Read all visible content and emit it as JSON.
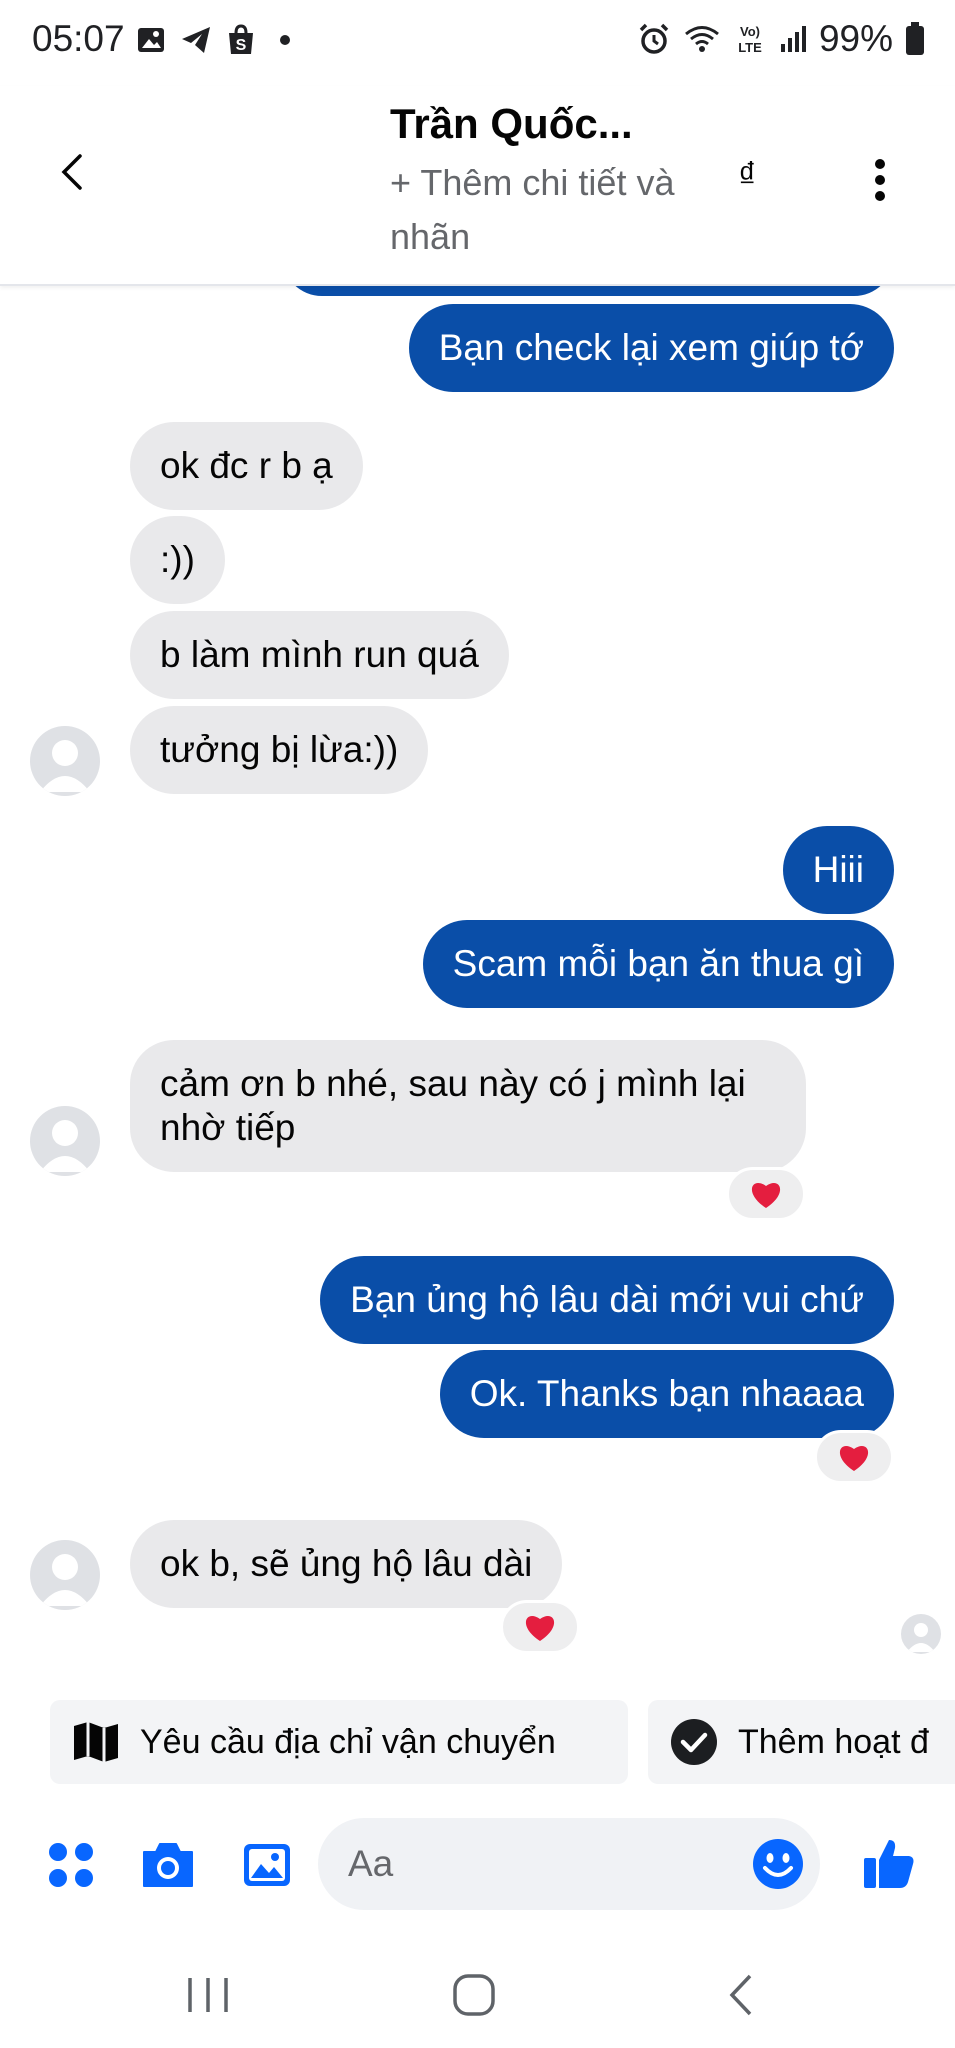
{
  "status_bar": {
    "time": "05:07",
    "battery": "99%",
    "left_icons": [
      "image-icon",
      "telegram-icon",
      "shopee-icon",
      "dot-icon"
    ],
    "right_icons": [
      "alarm-icon",
      "wifi-icon",
      "volte-icon",
      "signal-icon",
      "battery-icon"
    ],
    "volte_label_top": "Vo)",
    "volte_label_bottom": "LTE"
  },
  "header": {
    "contact_name": "Trần Quốc...",
    "add_details": "+ Thêm chi tiết và nhãn",
    "currency_symbol": "₫"
  },
  "messages": [
    {
      "direction": "out",
      "text": "Bạn check lại xem giúp tớ"
    },
    {
      "direction": "in",
      "text": "ok đc r b ạ"
    },
    {
      "direction": "in",
      "text": ":))"
    },
    {
      "direction": "in",
      "text": "b làm mình run quá"
    },
    {
      "direction": "in",
      "text": "tưởng bị lừa:))"
    },
    {
      "direction": "out",
      "text": "Hiii"
    },
    {
      "direction": "out",
      "text": "Scam mỗi bạn ăn thua gì"
    },
    {
      "direction": "in",
      "text": "cảm ơn b nhé, sau này có j mình lại nhờ tiếp",
      "reaction": "heart"
    },
    {
      "direction": "out",
      "text": "Bạn ủng hộ lâu dài mới vui chứ"
    },
    {
      "direction": "out",
      "text": "Ok. Thanks bạn nhaaaa",
      "reaction": "heart"
    },
    {
      "direction": "in",
      "text": "ok b, sẽ ủng hộ lâu dài",
      "reaction": "heart"
    }
  ],
  "quick_actions": [
    {
      "label": "Yêu cầu địa chỉ vận chuyển",
      "icon": "map-icon"
    },
    {
      "label": "Thêm hoạt đ",
      "icon": "check-circle-icon"
    }
  ],
  "composer": {
    "placeholder": "Aa",
    "icons": [
      "apps-icon",
      "camera-icon",
      "gallery-icon",
      "emoji-icon",
      "like-icon"
    ]
  },
  "colors": {
    "outgoing_bubble": "#0a4ea8",
    "incoming_bubble": "#e9e9eb",
    "accent": "#0866ff",
    "heart": "#e41e3f"
  }
}
